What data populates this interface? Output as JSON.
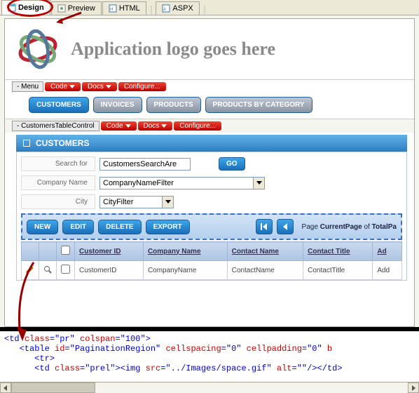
{
  "tabs": {
    "design": "Design",
    "preview": "Preview",
    "html": "HTML",
    "aspx": "ASPX"
  },
  "logo_text": "Application logo goes here",
  "menu_band": {
    "label": "- Menu",
    "code": "Code",
    "docs": "Docs",
    "configure": "Configure..."
  },
  "nav": {
    "customers": "CUSTOMERS",
    "invoices": "INVOICES",
    "products": "PRODUCTS",
    "products_by_cat": "PRODUCTS BY CATEGORY"
  },
  "ctc_band": {
    "label": "- CustomersTableControl",
    "code": "Code",
    "docs": "Docs",
    "configure": "Configure..."
  },
  "section_title": "CUSTOMERS",
  "labels": {
    "search_for": "Search for",
    "company_name": "Company Name",
    "city": "City"
  },
  "inputs": {
    "search_value": "CustomersSearchAre",
    "company_filter": "CompanyNameFilter",
    "city_filter": "CityFilter"
  },
  "buttons": {
    "go": "GO",
    "new": "NEW",
    "edit": "EDIT",
    "delete": "DELETE",
    "export": "EXPORT"
  },
  "pagination": {
    "page_word": "Page",
    "current": "CurrentPage",
    "of": "of",
    "total": "TotalPa"
  },
  "columns": {
    "cid": "Customer ID",
    "cname": "Company Name",
    "contact": "Contact Name",
    "title": "Contact Title",
    "addr": "Ad"
  },
  "row": {
    "cid": "CustomerID",
    "cname": "CompanyName",
    "contact": "ContactName",
    "title": "ContactTitle",
    "addr": "Add"
  },
  "code": {
    "l1a": "<td ",
    "l1b": "class",
    "l1c": "=\"pr\"",
    "l1d": " colspan",
    "l1e": "=\"100\">",
    "l2a": "   <table ",
    "l2b": "id",
    "l2c": "=\"PaginationRegion\"",
    "l2d": " cellspacing",
    "l2e": "=\"0\"",
    "l2f": " cellpadding",
    "l2g": "=\"0\"",
    "l2h": " b",
    "l3": "      <tr>",
    "l4a": "      <td ",
    "l4b": "class",
    "l4c": "=\"prel\">",
    "l4d": "<img ",
    "l4e": "src",
    "l4f": "=\"../Images/space.gif\"",
    "l4g": " alt",
    "l4h": "=\"\"/></",
    "l4i": "td>"
  }
}
